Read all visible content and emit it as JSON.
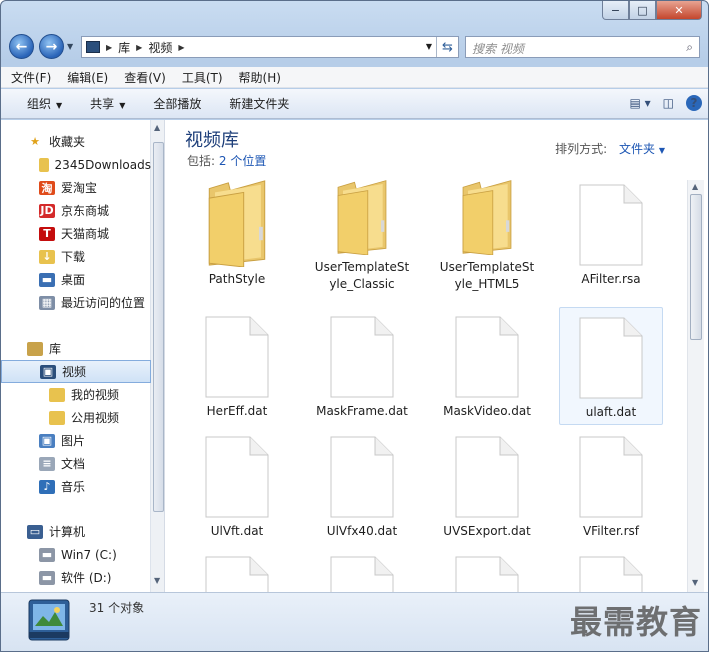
{
  "window": {
    "minimize": "−",
    "maximize": "□",
    "close": "✕"
  },
  "address": {
    "segments": [
      "库",
      "视频"
    ],
    "refresh_icon": "refresh-icon"
  },
  "search": {
    "placeholder": "搜索 视频"
  },
  "menu": [
    "文件(F)",
    "编辑(E)",
    "查看(V)",
    "工具(T)",
    "帮助(H)"
  ],
  "toolbar": {
    "organize": "组织",
    "share": "共享",
    "play_all": "全部播放",
    "new_folder": "新建文件夹"
  },
  "nav": {
    "favorites_label": "收藏夹",
    "favorites": [
      {
        "label": "2345Downloads",
        "icon": "folder-icon",
        "color": "#e8c24e"
      },
      {
        "label": "爱淘宝",
        "icon": "taobao-icon",
        "color": "#e04b1a"
      },
      {
        "label": "京东商城",
        "icon": "jd-icon",
        "color": "#d42a2a"
      },
      {
        "label": "天猫商城",
        "icon": "tmall-icon",
        "color": "#c40d0d"
      },
      {
        "label": "下载",
        "icon": "download-icon",
        "color": "#e8c24e"
      },
      {
        "label": "桌面",
        "icon": "desktop-icon",
        "color": "#3a6fb3"
      },
      {
        "label": "最近访问的位置",
        "icon": "recent-places-icon",
        "color": "#7e8ea6"
      }
    ],
    "libraries_label": "库",
    "libraries": [
      {
        "label": "视频",
        "icon": "video-library-icon",
        "selected": true,
        "indent": 1
      },
      {
        "label": "我的视频",
        "icon": "folder-icon",
        "indent": 2
      },
      {
        "label": "公用视频",
        "icon": "folder-icon",
        "indent": 2
      },
      {
        "label": "图片",
        "icon": "pictures-icon",
        "indent": 1
      },
      {
        "label": "文档",
        "icon": "documents-icon",
        "indent": 1
      },
      {
        "label": "音乐",
        "icon": "music-icon",
        "indent": 1
      }
    ],
    "computer_label": "计算机",
    "drives": [
      {
        "label": "Win7 (C:)",
        "icon": "drive-c-icon"
      },
      {
        "label": "软件 (D:)",
        "icon": "drive-d-icon"
      }
    ]
  },
  "library": {
    "title": "视频库",
    "includes_prefix": "包括:",
    "includes_link": "2 个位置",
    "arrange_label": "排列方式:",
    "arrange_value": "文件夹"
  },
  "files": [
    {
      "name": "PathStyle",
      "type": "folder"
    },
    {
      "name": "UserTemplateStyle_Classic",
      "type": "folder"
    },
    {
      "name": "UserTemplateStyle_HTML5",
      "type": "folder"
    },
    {
      "name": "AFilter.rsa",
      "type": "file"
    },
    {
      "name": "HerEff.dat",
      "type": "file"
    },
    {
      "name": "MaskFrame.dat",
      "type": "file"
    },
    {
      "name": "MaskVideo.dat",
      "type": "file"
    },
    {
      "name": "ulaft.dat",
      "type": "file",
      "selected": true
    },
    {
      "name": "UlVft.dat",
      "type": "file"
    },
    {
      "name": "UlVfx40.dat",
      "type": "file"
    },
    {
      "name": "UVSExport.dat",
      "type": "file"
    },
    {
      "name": "VFilter.rsf",
      "type": "file"
    },
    {
      "name": "",
      "type": "file"
    },
    {
      "name": "",
      "type": "file"
    },
    {
      "name": "",
      "type": "file"
    },
    {
      "name": "",
      "type": "file"
    }
  ],
  "status": {
    "count": "31 个对象",
    "watermark": "最需教育"
  }
}
